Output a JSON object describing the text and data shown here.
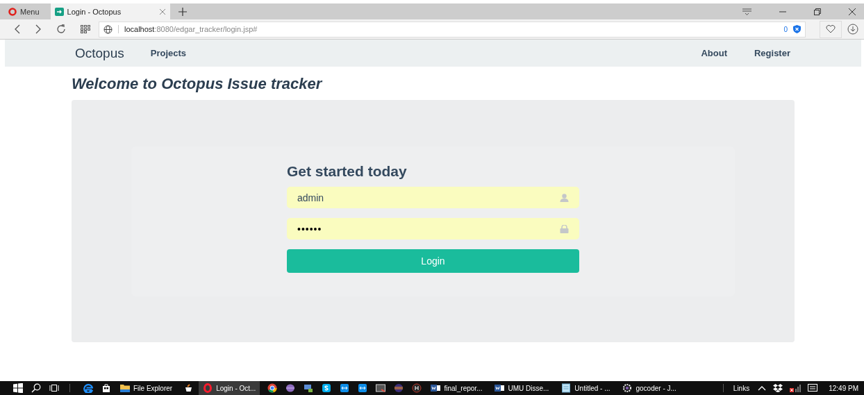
{
  "browser": {
    "menu_label": "Menu",
    "tabs": [
      {
        "title": "Login - Octopus",
        "selected": true
      }
    ],
    "address": {
      "host": "localhost",
      "path": ":8080/edgar_tracker/login.jsp#"
    },
    "blocked_count": "0"
  },
  "navbar": {
    "brand": "Octopus",
    "left_links": [
      {
        "label": "Projects"
      }
    ],
    "right_links": [
      {
        "label": "About"
      },
      {
        "label": "Register"
      }
    ]
  },
  "page": {
    "heading": "Welcome to Octopus Issue tracker"
  },
  "login_form": {
    "title": "Get started today",
    "fields": [
      {
        "kind": "user",
        "value": "admin"
      },
      {
        "kind": "lock",
        "value": "••••••"
      }
    ],
    "button": "Login"
  },
  "taskbar": {
    "items": [
      {
        "kind": "start",
        "selected": false
      },
      {
        "kind": "search",
        "selected": false
      },
      {
        "kind": "taskview",
        "selected": false
      },
      {
        "kind": "edge",
        "selected": false
      },
      {
        "kind": "store",
        "selected": false
      },
      {
        "kind": "folder",
        "label": "File Explorer",
        "selected": false
      },
      {
        "kind": "cup",
        "selected": false
      },
      {
        "kind": "opera",
        "label": "Login - Oct...",
        "selected": true
      },
      {
        "kind": "chrome",
        "selected": false
      },
      {
        "kind": "orb",
        "selected": false
      },
      {
        "kind": "remote",
        "selected": false
      },
      {
        "kind": "skype",
        "selected": false
      },
      {
        "kind": "teamviewer",
        "selected": false
      },
      {
        "kind": "teamviewer",
        "selected": false
      },
      {
        "kind": "window",
        "selected": false
      },
      {
        "kind": "eclipse",
        "selected": false
      },
      {
        "kind": "db",
        "selected": false
      },
      {
        "kind": "word",
        "label": "final_repor...",
        "selected": false
      },
      {
        "kind": "word",
        "label": "UMU Disse...",
        "selected": false
      },
      {
        "kind": "notepad",
        "label": "Untitled - ...",
        "selected": false
      },
      {
        "kind": "gear",
        "label": "gocoder - J...",
        "selected": false
      }
    ],
    "tray": {
      "links_label": "Links",
      "time": "12:49 PM"
    }
  }
}
